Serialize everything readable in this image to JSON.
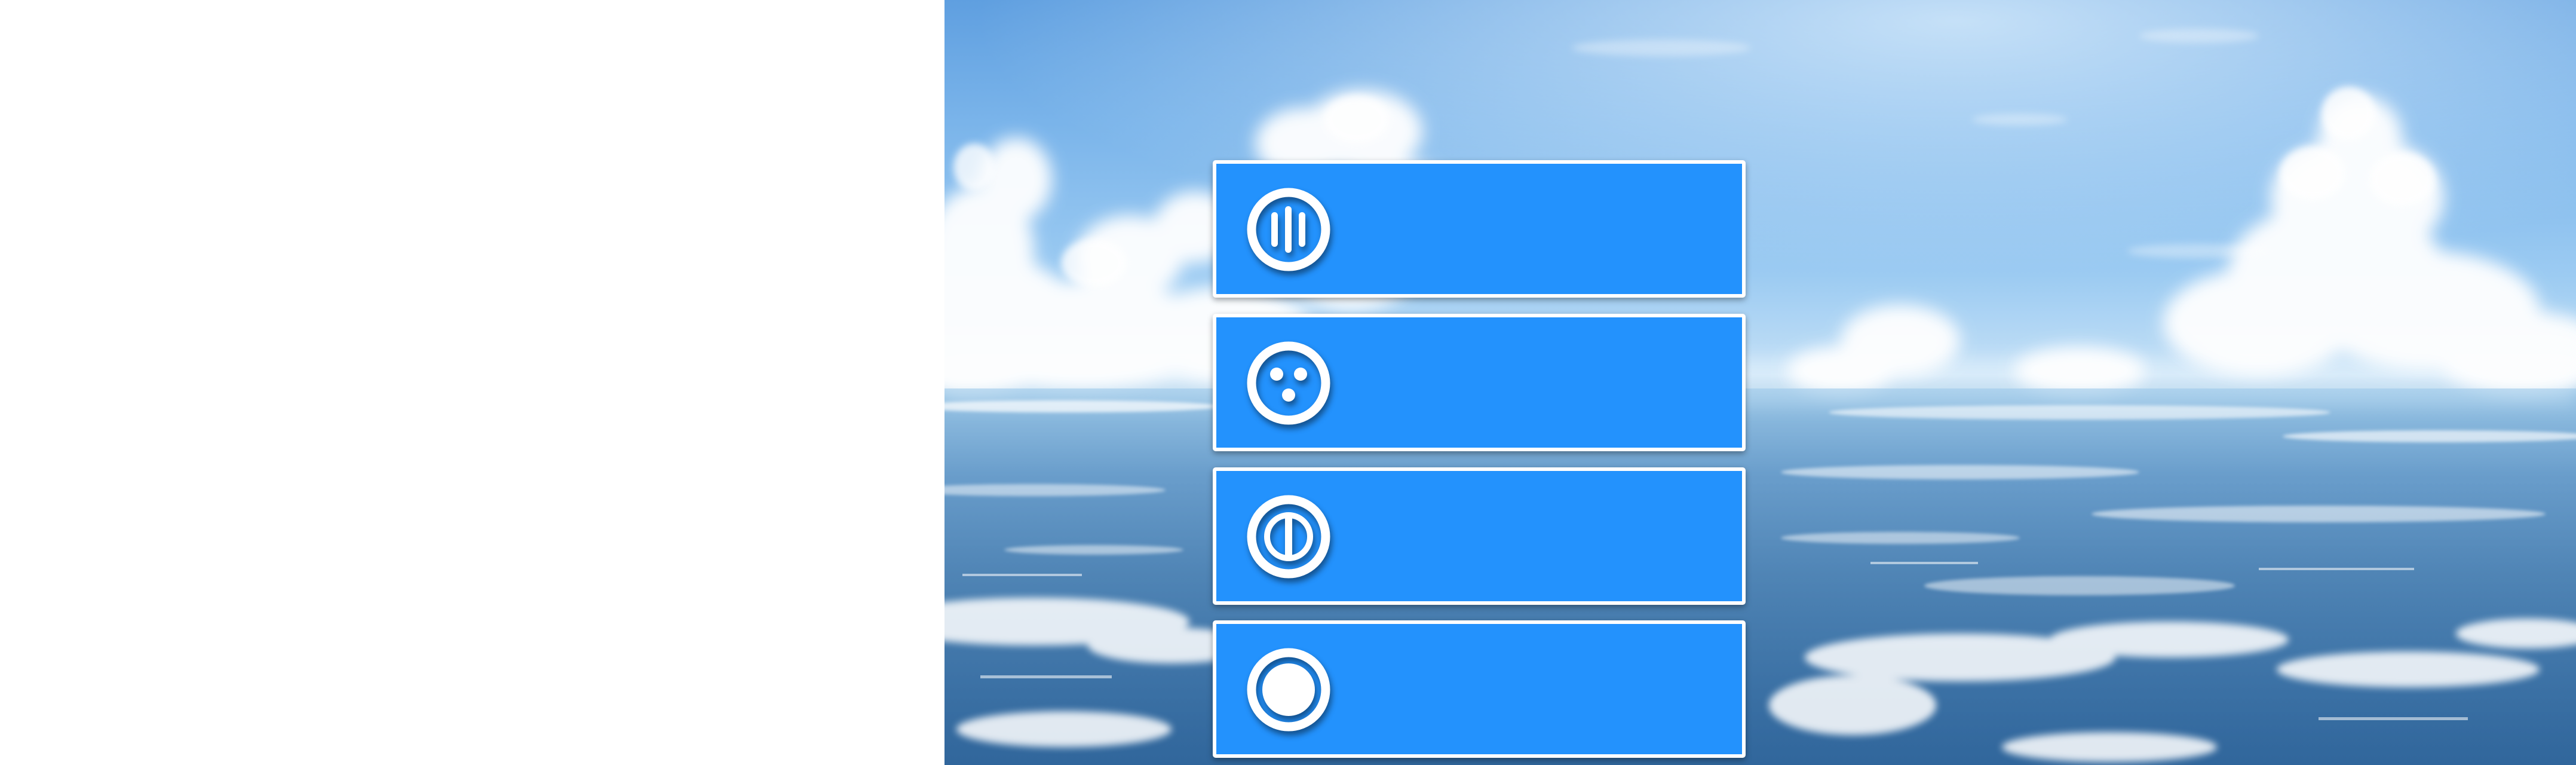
{
  "scene": {
    "background": "sky and sea",
    "button_color": "#2392fd",
    "border_color": "#ffffff"
  },
  "menu": {
    "buttons": [
      {
        "icon": "three-bars-circle-icon",
        "label": ""
      },
      {
        "icon": "three-dots-circle-icon",
        "label": ""
      },
      {
        "icon": "split-circle-icon",
        "label": ""
      },
      {
        "icon": "filled-circle-icon",
        "label": ""
      }
    ]
  }
}
